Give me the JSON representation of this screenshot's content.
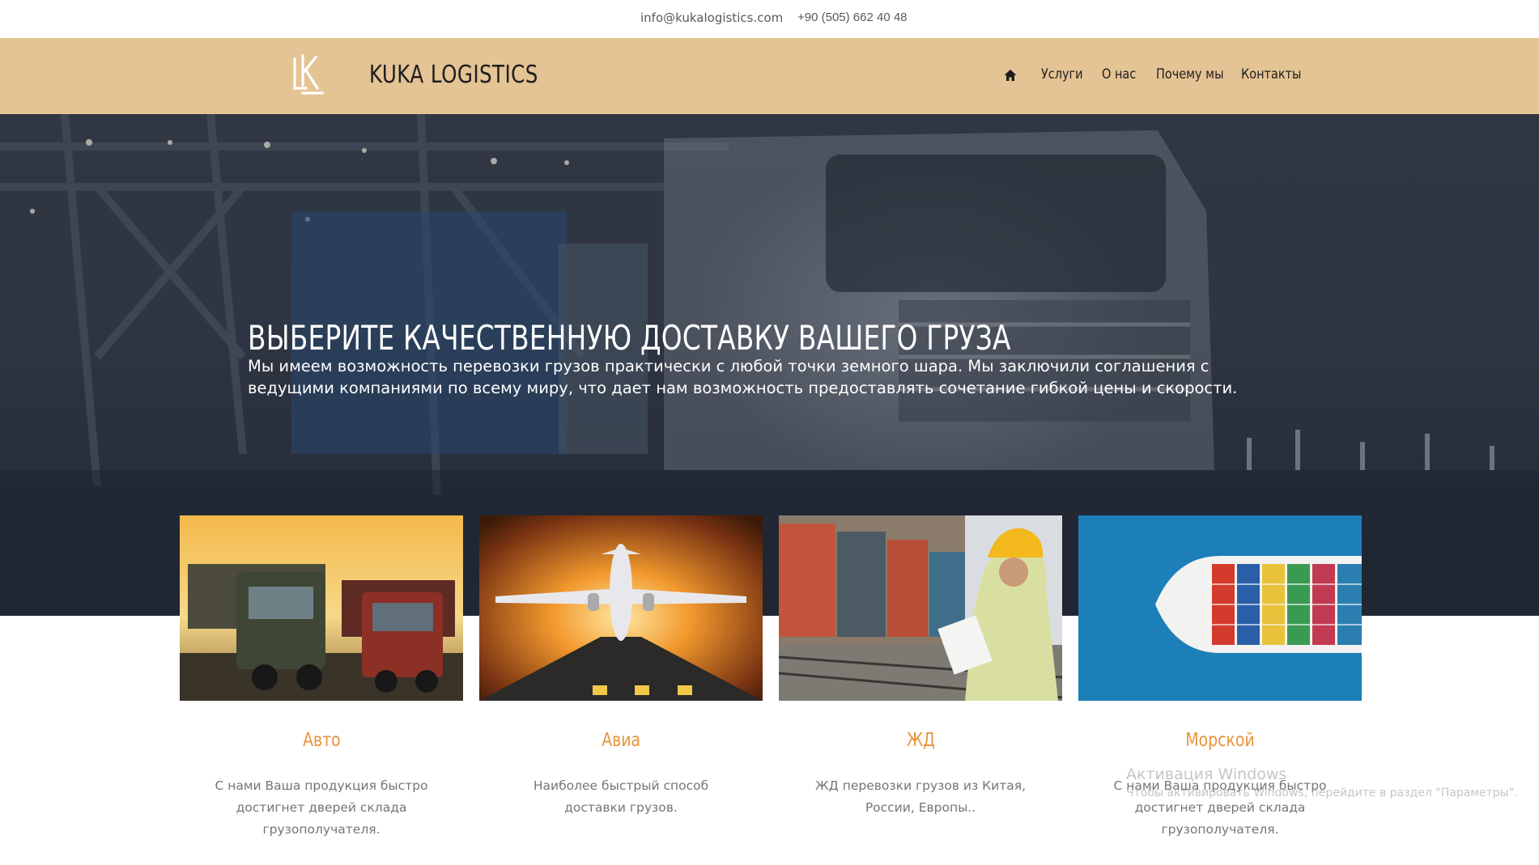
{
  "topbar": {
    "email": "info@kukalogistics.com",
    "phone": "+90 (505) 662 40 48"
  },
  "header": {
    "brand": "KUKA LOGISTICS",
    "nav": {
      "home_icon": "home-icon",
      "items": [
        "Услуги",
        "О нас",
        "Почему мы",
        "Контакты"
      ]
    }
  },
  "hero": {
    "title": "ВЫБЕРИТЕ КАЧЕСТВЕННУЮ ДОСТАВКУ ВАШЕГО ГРУЗА",
    "subtitle": "Мы имеем возможность перевозки грузов практически с любой точки земного шара. Мы заключили соглашения с ведущими компаниями по всему миру, что дает нам возможность предоставлять сочетание гибкой цены и скорости."
  },
  "services": [
    {
      "title": "Авто",
      "description": "С нами Ваша продукция быстро достигнет дверей склада грузополучателя."
    },
    {
      "title": "Авиа",
      "description": "Наиболее быстрый способ доставки грузов."
    },
    {
      "title": "ЖД",
      "description": "ЖД перевозки грузов из Китая, России, Европы.."
    },
    {
      "title": "Морской",
      "description": "С нами Ваша продукция быстро достигнет дверей склада грузополучателя."
    }
  ],
  "watermark": {
    "line1": "Активация Windows",
    "line2": "Чтобы активировать Windows, перейдите в раздел \"Параметры\"."
  },
  "colors": {
    "header_bg": "#e4c394",
    "accent": "#e8933a",
    "text_muted": "#757575"
  }
}
